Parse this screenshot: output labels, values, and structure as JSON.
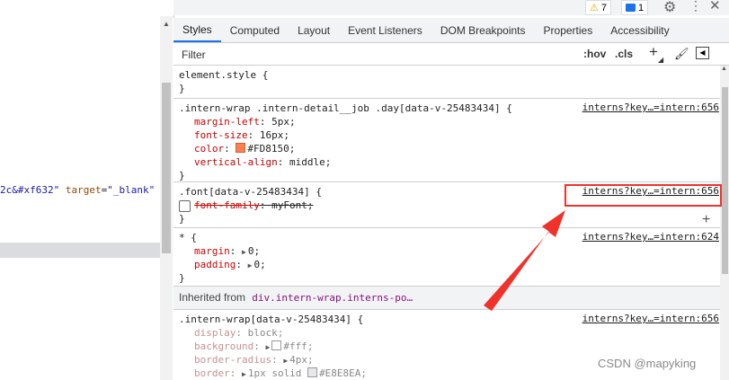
{
  "left_pane": {
    "code_attr_tail": "2c&#xf632\"",
    "code_attr_name": "target",
    "code_attr_value": "\"_blank\""
  },
  "toolbar": {
    "warning_count": "7",
    "message_count": "1"
  },
  "tabs": [
    "Styles",
    "Computed",
    "Layout",
    "Event Listeners",
    "DOM Breakpoints",
    "Properties",
    "Accessibility"
  ],
  "filter": {
    "placeholder": "Filter",
    "hov": ":hov",
    "cls": ".cls"
  },
  "rules": {
    "element_style": {
      "open": "element.style {",
      "close": "}"
    },
    "day": {
      "selector": ".intern-wrap .intern-detail__job .day[data-v-25483434] {",
      "source": "interns?key…=intern:656",
      "props": [
        {
          "name": "margin-left",
          "value": "5px"
        },
        {
          "name": "font-size",
          "value": "16px"
        },
        {
          "name": "color",
          "value": "#FD8150",
          "swatch": "#FD8150"
        },
        {
          "name": "vertical-align",
          "value": "middle"
        }
      ],
      "close": "}"
    },
    "font": {
      "selector": ".font[data-v-25483434] {",
      "source": "interns?key…=intern:656",
      "prop_name": "font-family",
      "prop_value": "myFont",
      "close": "}"
    },
    "universal": {
      "selector": "* {",
      "source": "interns?key…=intern:624",
      "props": [
        {
          "name": "margin",
          "value": "0"
        },
        {
          "name": "padding",
          "value": "0"
        }
      ],
      "close": "}"
    },
    "inherited": {
      "label": "Inherited from",
      "element": "div.intern-wrap.interns-po…"
    },
    "intern_wrap": {
      "selector": ".intern-wrap[data-v-25483434] {",
      "source": "interns?key…=intern:656",
      "props": [
        {
          "name": "display",
          "value": "block"
        },
        {
          "name": "background",
          "value": "#fff",
          "swatch": "#ffffff"
        },
        {
          "name": "border-radius",
          "value": "4px"
        },
        {
          "name": "border",
          "value": "1px solid",
          "value2": "#E8E8EA",
          "swatch": "#E8E8EA"
        }
      ]
    }
  },
  "colors": {
    "accent": "#1a73e8",
    "annotation": "#f0322a",
    "property_name": "#c80000"
  },
  "watermark": "CSDN @mapyking"
}
